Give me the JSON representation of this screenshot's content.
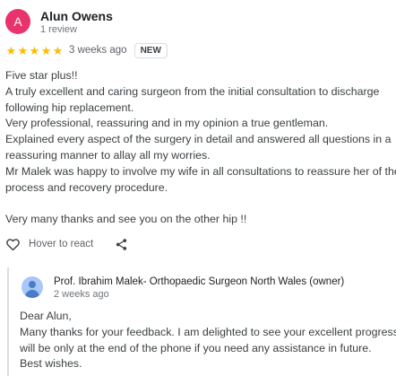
{
  "review": {
    "avatar_letter": "A",
    "avatar_color": "#e8336d",
    "name": "Alun Owens",
    "review_count": "1 review",
    "rating": 5,
    "rating_max": 5,
    "star_glyph": "★",
    "star_color": "#fbbc04",
    "date": "3 weeks ago",
    "badge": "NEW",
    "body": [
      "Five star plus!!",
      "A truly excellent and caring surgeon from the initial consultation to discharge",
      "following hip replacement.",
      "Very professional, reassuring and in my opinion a true gentleman.",
      "Explained every aspect of the surgery in detail and answered all questions in a",
      "reassuring manner to allay all my worries.",
      "Mr Malek was happy to involve my wife in all consultations to reassure her of the",
      "process and recovery procedure.",
      "",
      "Very many thanks and see you on the other hip !!"
    ]
  },
  "actions": {
    "like_icon": "heart-outline-icon",
    "hover_label": "Hover to react",
    "share_icon": "share-icon"
  },
  "owner_reply": {
    "avatar_icon": "person-icon",
    "name": "Prof. Ibrahim Malek- Orthopaedic Surgeon North Wales (owner)",
    "date": "2 weeks ago",
    "body": [
      "Dear Alun,",
      "Many thanks for your feedback. I am delighted to see your excellent progress. I",
      "will be only at the end of the phone if you need any assistance in future.",
      "Best wishes."
    ]
  }
}
